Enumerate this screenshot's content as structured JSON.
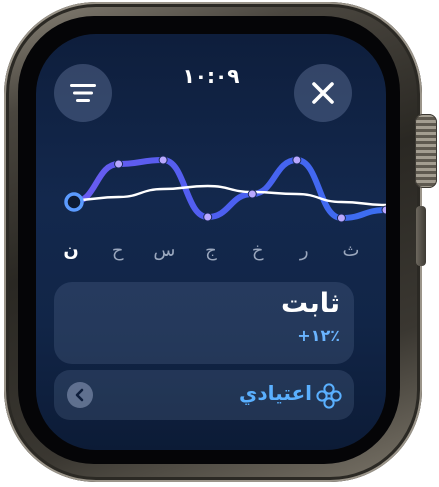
{
  "status_bar": {
    "time": "١٠:٠٩"
  },
  "header": {
    "menu_icon": "list-icon",
    "close_icon": "close-icon"
  },
  "chart_data": {
    "type": "line",
    "series": [
      {
        "values": [
          50,
          88,
          92,
          35,
          58,
          92,
          34,
          42
        ]
      },
      {
        "values": [
          52,
          55,
          63,
          66,
          60,
          58,
          50,
          47
        ]
      }
    ],
    "highlight_color": "#5b9bff",
    "series_color": "#5a6cf0",
    "baseline_color": "#ffffff"
  },
  "days": [
    "ن",
    "ح",
    "س",
    "ج",
    "خ",
    "ر",
    "ث"
  ],
  "active_day_index": 0,
  "status_card": {
    "title": "ثابت",
    "subtitle": "+١٢٪"
  },
  "mode": {
    "label": "اعتيادي",
    "icon": "flower-icon",
    "back_icon": "chevron-left-icon",
    "accent_color": "#5ab0ff"
  }
}
